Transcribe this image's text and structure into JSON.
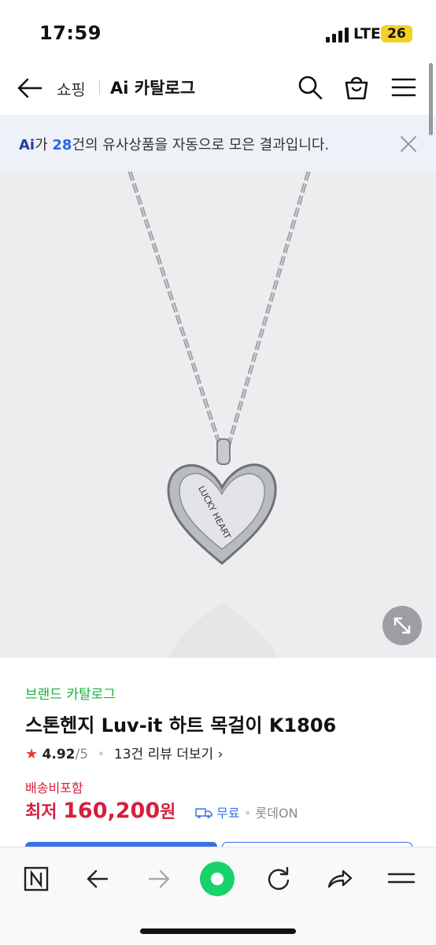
{
  "status": {
    "time": "17:59",
    "network": "LTE",
    "battery": "26"
  },
  "header": {
    "shop_label": "쇼핑",
    "title": "Ai 카탈로그"
  },
  "banner": {
    "ai_logo": "Ai",
    "prefix": "가 ",
    "count": "28",
    "suffix": "건의 유사상품을 자동으로 모은 결과입니다."
  },
  "product": {
    "image_text": "LUCKY HEART",
    "brand_link": "브랜드 카탈로그",
    "title": "스톤헨지 Luv-it 하트 목걸이 K1806",
    "rating": "4.92",
    "rating_max": "/5",
    "reviews": "13건 리뷰 더보기",
    "shipping_note": "배송비포함",
    "price_prefix": "최저 ",
    "price": "160,200",
    "price_unit": "원",
    "delivery": "무료",
    "seller": "롯데ON"
  },
  "colors": {
    "accent": "#3d6ee8",
    "price": "#d61f3c",
    "brand": "#19b03b"
  }
}
